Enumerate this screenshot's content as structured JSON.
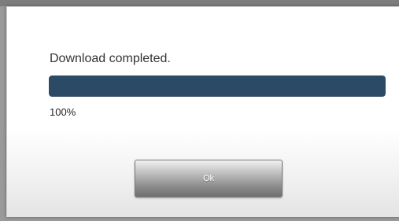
{
  "dialog": {
    "message": "Download completed.",
    "progress": {
      "percent_text": "100%",
      "value": 1.0,
      "fill_color": "#2b4a66"
    },
    "ok_label": "Ok"
  }
}
